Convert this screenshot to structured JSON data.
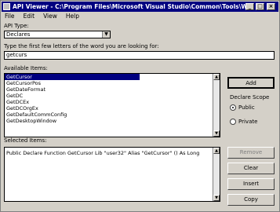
{
  "window": {
    "title": "API Viewer - C:\\Program Files\\Microsoft Visual Studio\\Common\\Tools\\Win..."
  },
  "menu": [
    "File",
    "Edit",
    "View",
    "Help"
  ],
  "api_type": {
    "label": "API Type:",
    "value": "Declares"
  },
  "search": {
    "label": "Type the first few letters of the word you are looking for:",
    "value": "getcurs"
  },
  "available": {
    "label": "Available Items:",
    "items": [
      "GetCursor",
      "GetCursorPos",
      "GetDateFormat",
      "GetDC",
      "GetDCEx",
      "GetDCOrgEx",
      "GetDefaultCommConfig",
      "GetDesktopWindow"
    ],
    "selected_index": 0
  },
  "buttons": {
    "add": "Add",
    "remove": "Remove",
    "clear": "Clear",
    "insert": "Insert",
    "copy": "Copy"
  },
  "declare_scope": {
    "label": "Declare Scope",
    "public": "Public",
    "private": "Private",
    "selected": "public"
  },
  "selected": {
    "label": "Selected Items:",
    "text": "Public Declare Function GetCursor Lib \"user32\" Alias \"GetCursor\" () As Long"
  }
}
